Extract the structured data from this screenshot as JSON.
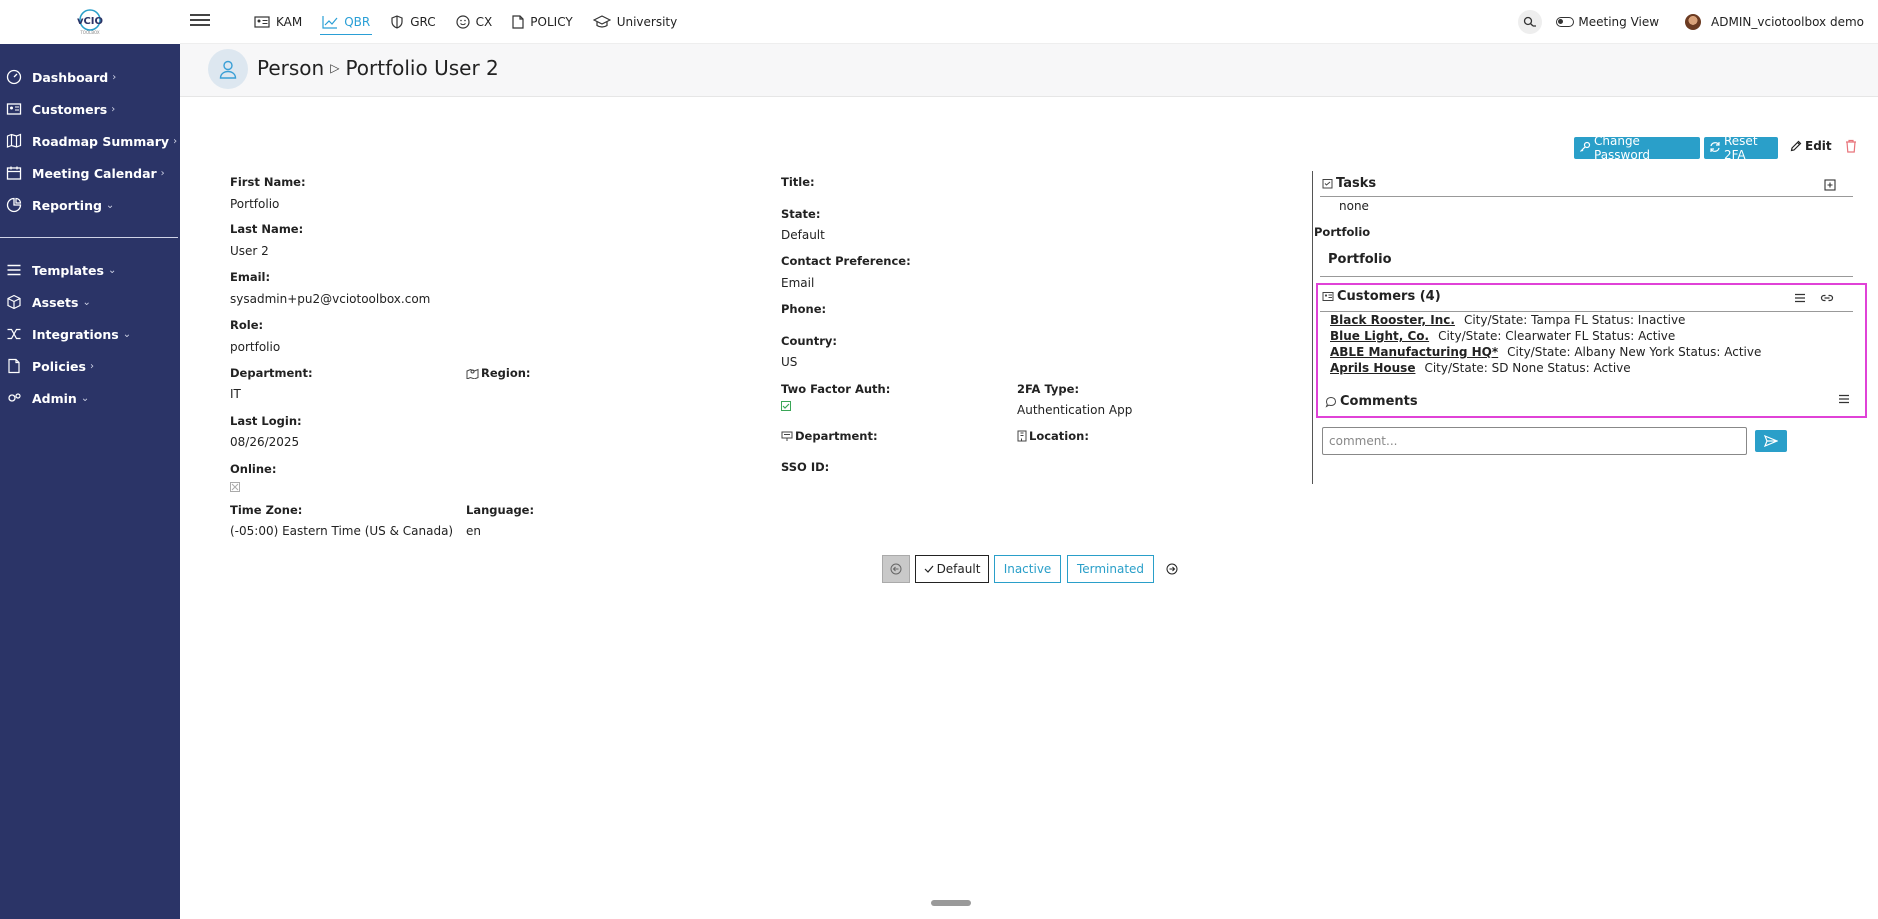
{
  "app": {
    "logo_text": "vCIO"
  },
  "sidebar": {
    "items": [
      {
        "label": "Dashboard",
        "chevron": "›",
        "icon": "dashboard-icon"
      },
      {
        "label": "Customers",
        "chevron": "›",
        "icon": "customers-icon"
      },
      {
        "label": "Roadmap Summary",
        "chevron": "›",
        "icon": "map-icon"
      },
      {
        "label": "Meeting Calendar",
        "chevron": "›",
        "icon": "calendar-icon"
      },
      {
        "label": "Reporting",
        "chevron": "⌄",
        "icon": "reporting-icon"
      },
      {
        "label": "Templates",
        "chevron": "⌄",
        "icon": "templates-icon"
      },
      {
        "label": "Assets",
        "chevron": "⌄",
        "icon": "assets-icon"
      },
      {
        "label": "Integrations",
        "chevron": "⌄",
        "icon": "integrations-icon"
      },
      {
        "label": "Policies",
        "chevron": "›",
        "icon": "policies-icon"
      },
      {
        "label": "Admin",
        "chevron": "⌄",
        "icon": "admin-icon"
      }
    ]
  },
  "topnav": {
    "tabs": [
      {
        "label": "KAM",
        "icon": "id-card-icon",
        "active": false
      },
      {
        "label": "QBR",
        "icon": "chart-icon",
        "active": true
      },
      {
        "label": "GRC",
        "icon": "shield-icon",
        "active": false
      },
      {
        "label": "CX",
        "icon": "smile-icon",
        "active": false
      },
      {
        "label": "POLICY",
        "icon": "document-icon",
        "active": false
      },
      {
        "label": "University",
        "icon": "graduation-cap-icon",
        "active": false
      }
    ],
    "meeting_view_label": "Meeting View",
    "user_label": "ADMIN_vciotoolbox demo"
  },
  "header": {
    "entity_type": "Person",
    "separator": "▷",
    "title": "Portfolio User 2"
  },
  "actions": {
    "change_password": "Change Password",
    "reset_2fa": "Reset 2FA",
    "edit": "Edit"
  },
  "fields": {
    "first_name_label": "First Name:",
    "first_name": "Portfolio",
    "last_name_label": "Last Name:",
    "last_name": "User 2",
    "email_label": "Email:",
    "email": "sysadmin+pu2@vciotoolbox.com",
    "role_label": "Role:",
    "role": "portfolio",
    "department_label": "Department:",
    "department": "IT",
    "region_label": "Region:",
    "last_login_label": "Last Login:",
    "last_login": "08/26/2025",
    "online_label": "Online:",
    "time_zone_label": "Time Zone:",
    "time_zone": "(-05:00) Eastern Time (US & Canada)",
    "language_label": "Language:",
    "language": "en",
    "title_label": "Title:",
    "state_label": "State:",
    "state": "Default",
    "contact_pref_label": "Contact Preference:",
    "contact_pref": "Email",
    "phone_label": "Phone:",
    "country_label": "Country:",
    "country": "US",
    "two_factor_label": "Two Factor Auth:",
    "twofa_type_label": "2FA Type:",
    "twofa_type": "Authentication App",
    "department2_label": "Department:",
    "location_label": "Location:",
    "sso_label": "SSO ID:"
  },
  "status_bar": {
    "default": "Default",
    "inactive": "Inactive",
    "terminated": "Terminated"
  },
  "right_panel": {
    "tasks_title": "Tasks",
    "tasks_value": "none",
    "portfolio_label": "Portfolio",
    "portfolio_title": "Portfolio",
    "customers_title": "Customers (4)",
    "customers": [
      {
        "name": "Black Rooster, Inc.",
        "info": "City/State:  Tampa FL Status:  Inactive"
      },
      {
        "name": "Blue Light, Co.",
        "info": "City/State:  Clearwater FL Status:  Active"
      },
      {
        "name": "ABLE Manufacturing HQ*",
        "info": "City/State:  Albany New York Status:  Active"
      },
      {
        "name": "Aprils House",
        "info": "City/State:  SD None Status:  Active"
      }
    ],
    "comments_title": "Comments",
    "comment_placeholder": "comment..."
  },
  "colors": {
    "sidebar": "#2b3467",
    "accent": "#2a9fc9",
    "highlight": "#e042d7"
  }
}
